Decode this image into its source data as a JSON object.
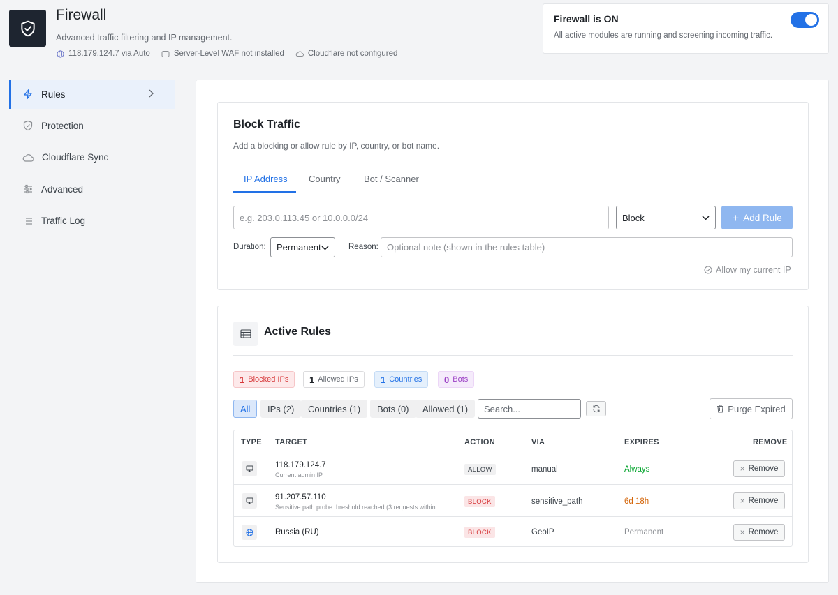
{
  "header": {
    "title": "Firewall",
    "subtitle": "Advanced traffic filtering and IP management.",
    "meta": {
      "ip": "118.179.124.7 via Auto",
      "waf": "Server-Level WAF not installed",
      "cloudflare": "Cloudflare not configured"
    }
  },
  "status": {
    "title": "Firewall is ON",
    "description": "All active modules are running and screening incoming traffic.",
    "enabled": true
  },
  "sidebar": {
    "items": [
      {
        "label": "Rules",
        "icon": "bolt-icon",
        "active": true
      },
      {
        "label": "Protection",
        "icon": "shield-icon"
      },
      {
        "label": "Cloudflare Sync",
        "icon": "cloud-icon"
      },
      {
        "label": "Advanced",
        "icon": "sliders-icon"
      },
      {
        "label": "Traffic Log",
        "icon": "list-icon"
      }
    ]
  },
  "block": {
    "title": "Block Traffic",
    "description": "Add a blocking or allow rule by IP, country, or bot name.",
    "tabs": [
      "IP Address",
      "Country",
      "Bot / Scanner"
    ],
    "ip_placeholder": "e.g. 203.0.113.45 or 10.0.0.0/24",
    "action_value": "Block",
    "add_label": "Add Rule",
    "duration_label": "Duration:",
    "duration_value": "Permanent",
    "reason_label": "Reason:",
    "reason_placeholder": "Optional note (shown in the rules table)",
    "allow_current_ip": "Allow my current IP"
  },
  "rules": {
    "title": "Active Rules",
    "badges": [
      {
        "count": "1",
        "label": "Blocked IPs"
      },
      {
        "count": "1",
        "label": "Allowed IPs"
      },
      {
        "count": "1",
        "label": "Countries"
      },
      {
        "count": "0",
        "label": "Bots"
      }
    ],
    "filters": [
      "All",
      "IPs (2)",
      "Countries (1)",
      "Bots (0)",
      "Allowed (1)"
    ],
    "search_placeholder": "Search...",
    "purge_label": "Purge Expired",
    "columns": [
      "TYPE",
      "TARGET",
      "ACTION",
      "VIA",
      "EXPIRES",
      "REMOVE"
    ],
    "rows": [
      {
        "type_icon": "monitor-icon",
        "target": "118.179.124.7",
        "sub": "Current admin IP",
        "action": "ALLOW",
        "via": "manual",
        "expires": "Always",
        "remove": "Remove"
      },
      {
        "type_icon": "monitor-icon",
        "target": "91.207.57.110",
        "sub": "Sensitive path probe threshold reached (3 requests within ...",
        "action": "BLOCK",
        "via": "sensitive_path",
        "expires": "6d 18h",
        "remove": "Remove"
      },
      {
        "type_icon": "globe-icon",
        "target": "Russia (RU)",
        "sub": "",
        "action": "BLOCK",
        "via": "GeoIP",
        "expires": "Permanent",
        "remove": "Remove"
      }
    ]
  },
  "colors": {
    "accent": "#2271e6",
    "block_red": "#d63638",
    "allow_green": "#00a32a",
    "expires_orange": "#d4660a"
  }
}
